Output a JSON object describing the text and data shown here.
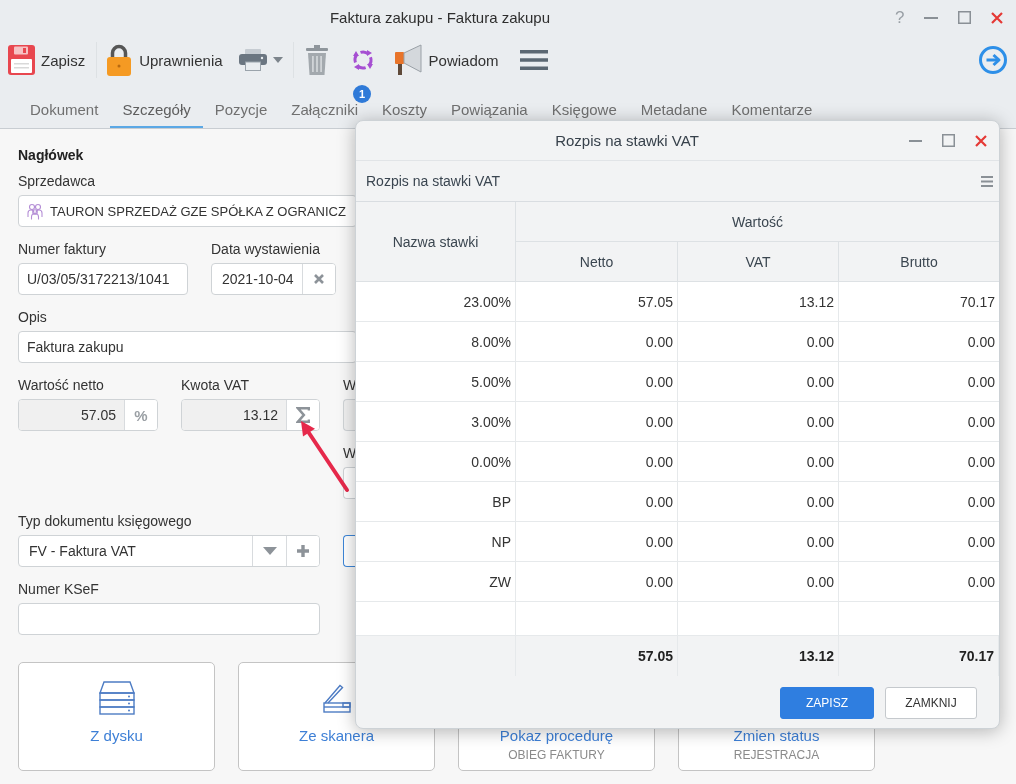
{
  "window": {
    "title": "Faktura zakupu - Faktura zakupu",
    "help": "?"
  },
  "toolbar": {
    "save_label": "Zapisz",
    "permissions_label": "Uprawnienia",
    "notify_label": "Powiadom"
  },
  "tabs": [
    {
      "label": "Dokument",
      "selected": false
    },
    {
      "label": "Szczegóły",
      "selected": true
    },
    {
      "label": "Pozycje",
      "selected": false
    },
    {
      "label": "Załączniki",
      "selected": false,
      "badge": "1"
    },
    {
      "label": "Koszty",
      "selected": false
    },
    {
      "label": "Powiązania",
      "selected": false
    },
    {
      "label": "Księgowe",
      "selected": false
    },
    {
      "label": "Metadane",
      "selected": false
    },
    {
      "label": "Komentarze",
      "selected": false
    }
  ],
  "form": {
    "section_title": "Nagłówek",
    "seller": {
      "label": "Sprzedawca",
      "value": "TAURON SPRZEDAŻ GZE SPÓŁKA Z OGRANICZ"
    },
    "invoice_number": {
      "label": "Numer faktury",
      "value": "U/03/05/3172213/1041"
    },
    "issue_date": {
      "label": "Data wystawienia",
      "value": "2021-10-04"
    },
    "description": {
      "label": "Opis",
      "value": "Faktura zakupu"
    },
    "net_value": {
      "label": "Wartość netto",
      "value": "57.05",
      "suffix": "%"
    },
    "vat_amount": {
      "label": "Kwota VAT",
      "value": "13.12"
    },
    "field_3": {
      "label": "W"
    },
    "field_4": {
      "label": "W"
    },
    "document_type": {
      "label": "Typ dokumentu księgowego",
      "value": "FV - Faktura VAT"
    },
    "ksef_number": {
      "label": "Numer KSeF"
    }
  },
  "tiles": [
    {
      "label": "Z dysku"
    },
    {
      "label": "Ze skanera"
    },
    {
      "label": "Pokaz procedurę",
      "sublabel": "OBIEG FAKTURY"
    },
    {
      "label": "Zmien status",
      "sublabel": "REJESTRACJA"
    }
  ],
  "dialog": {
    "title": "Rozpis na stawki VAT",
    "panel_title": "Rozpis na stawki VAT",
    "columns": {
      "rate": "Nazwa stawki",
      "value_group": "Wartość",
      "net": "Netto",
      "vat": "VAT",
      "gross": "Brutto"
    },
    "rows": [
      {
        "rate": "23.00%",
        "net": "57.05",
        "vat": "13.12",
        "gross": "70.17"
      },
      {
        "rate": "8.00%",
        "net": "0.00",
        "vat": "0.00",
        "gross": "0.00"
      },
      {
        "rate": "5.00%",
        "net": "0.00",
        "vat": "0.00",
        "gross": "0.00"
      },
      {
        "rate": "3.00%",
        "net": "0.00",
        "vat": "0.00",
        "gross": "0.00"
      },
      {
        "rate": "0.00%",
        "net": "0.00",
        "vat": "0.00",
        "gross": "0.00"
      },
      {
        "rate": "BP",
        "net": "0.00",
        "vat": "0.00",
        "gross": "0.00"
      },
      {
        "rate": "NP",
        "net": "0.00",
        "vat": "0.00",
        "gross": "0.00"
      },
      {
        "rate": "ZW",
        "net": "0.00",
        "vat": "0.00",
        "gross": "0.00"
      }
    ],
    "totals": {
      "net": "57.05",
      "vat": "13.12",
      "gross": "70.17"
    },
    "buttons": [
      {
        "label": "ZAPISZ",
        "primary": true
      },
      {
        "label": "ZAMKNIJ",
        "primary": false
      }
    ]
  }
}
